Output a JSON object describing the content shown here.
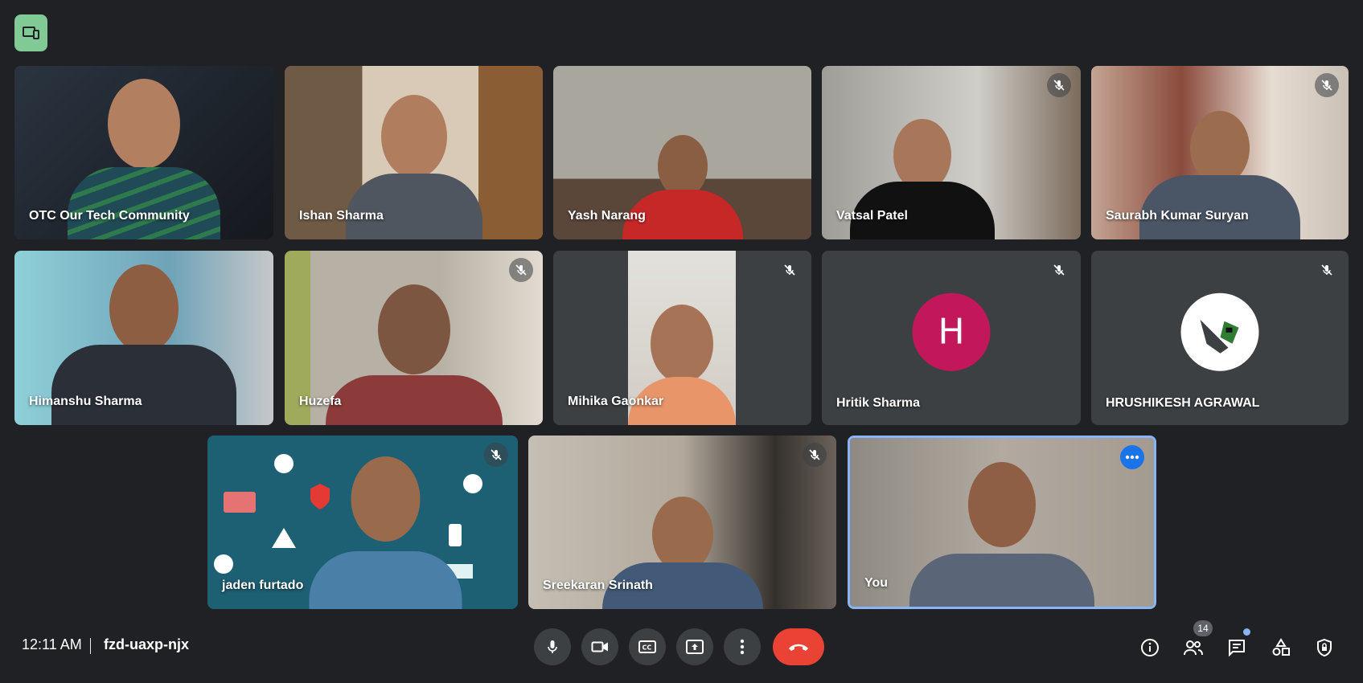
{
  "participants": [
    {
      "name": "OTC Our Tech Community",
      "muted": false,
      "bg": "#1f2a33"
    },
    {
      "name": "Ishan Sharma",
      "muted": false,
      "bg": "#8b6d4f"
    },
    {
      "name": "Yash Narang",
      "muted": false,
      "bg": "#6c6a63"
    },
    {
      "name": "Vatsal Patel",
      "muted": true,
      "bg": "#b8b6b0"
    },
    {
      "name": "Saurabh Kumar Suryan",
      "muted": true,
      "bg": "#a88670"
    },
    {
      "name": "Himanshu Sharma",
      "muted": false,
      "bg": "#7fb3c4"
    },
    {
      "name": "Huzefa",
      "muted": true,
      "bg": "#8f9474"
    },
    {
      "name": "Mihika Gaonkar",
      "muted": true,
      "bg": "#3c4043"
    },
    {
      "name": "Hritik Sharma",
      "muted": true,
      "avatar_letter": "H",
      "avatar_color": "#c2185b"
    },
    {
      "name": "HRUSHIKESH AGRAWAL",
      "muted": true
    },
    {
      "name": "jaden furtado",
      "muted": true,
      "bg": "#1d5f73"
    },
    {
      "name": "Sreekaran Srinath",
      "muted": true,
      "bg": "#b2a99c"
    },
    {
      "name": "You",
      "muted": false,
      "self": true,
      "bg": "#a39b90"
    }
  ],
  "footer": {
    "time": "12:11 AM",
    "meeting_code": "fzd-uaxp-njx",
    "people_count": "14"
  },
  "controls": [
    "mic-icon",
    "camera-icon",
    "captions-icon",
    "present-icon",
    "more-options-icon",
    "end-call-icon"
  ],
  "right_icons": [
    "info-icon",
    "people-icon",
    "chat-icon",
    "activities-icon",
    "host-controls-icon"
  ],
  "colors": {
    "background": "#202124",
    "tile": "#3c4043",
    "end_call": "#ea4335",
    "self_border": "#8ab4f8",
    "badge_green": "#81c995"
  }
}
